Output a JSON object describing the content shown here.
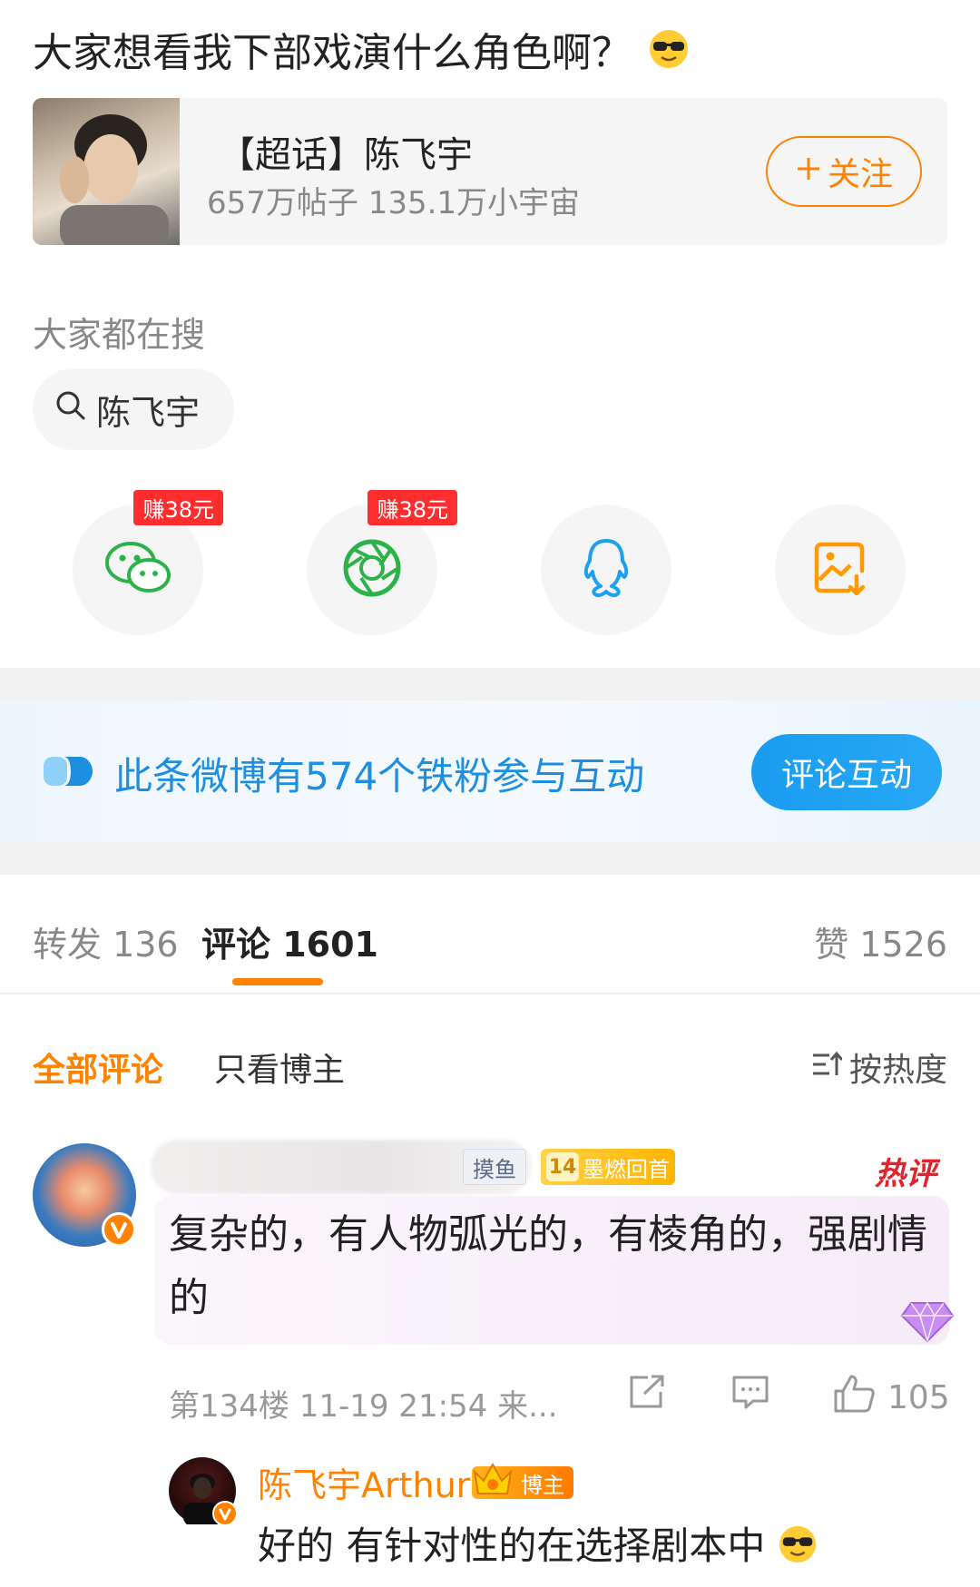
{
  "post": {
    "text": "大家想看我下部戏演什么角色啊？",
    "emoji": "sunglasses-emoji"
  },
  "topic": {
    "title": "【超话】陈飞宇",
    "stats": "657万帖子 135.1万小宇宙",
    "follow_label": "关注"
  },
  "hot_search": {
    "label": "大家都在搜",
    "keyword": "陈飞宇"
  },
  "share": {
    "wechat_badge": "赚38元",
    "moments_badge": "赚38元",
    "accent_wechat": "#2bb34a",
    "accent_qq": "#1ea0f0",
    "accent_save": "#ff9a00"
  },
  "fans_banner": {
    "text": "此条微博有574个铁粉参与互动",
    "button": "评论互动"
  },
  "tabs": {
    "repost": "转发 136",
    "comments": "评论 1601",
    "likes": "赞 1526"
  },
  "filters": {
    "all": "全部评论",
    "blogger_only": "只看博主",
    "sort": "按热度"
  },
  "comment": {
    "tag_fish": "摸鱼",
    "level": "14",
    "level_title": "墨燃回首",
    "hot_label": "热评",
    "text": "复杂的，有人物弧光的，有棱角的，强剧情的",
    "meta": "第134楼 11-19 21:54 来...",
    "like_count": "105"
  },
  "reply": {
    "name": "陈飞宇Arthur",
    "badge": "博主",
    "text": "好的 有针对性的在选择剧本中"
  }
}
